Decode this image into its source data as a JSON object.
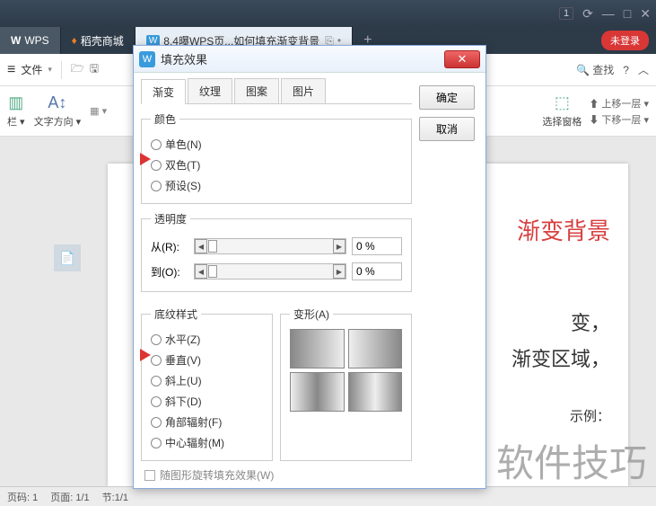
{
  "titlebar": {
    "count": "1"
  },
  "tabs": {
    "app": "WPS",
    "mall": "稻壳商城",
    "doc": "8.4曝WPS页...如何填充渐变背景",
    "login": "未登录"
  },
  "ribbon": {
    "file": "文件",
    "find": "查找"
  },
  "toolbar": {
    "col": "栏",
    "text_dir": "文字方向",
    "select_pane": "选择窗格",
    "up_layer": "上移一层",
    "down_layer": "下移一层"
  },
  "doc": {
    "title": "渐变背景",
    "line1": "变，",
    "line2": "渐变区域，",
    "example": "示例："
  },
  "dialog": {
    "title": "填充效果",
    "tabs": {
      "gradient": "渐变",
      "texture": "纹理",
      "pattern": "图案",
      "picture": "图片"
    },
    "ok": "确定",
    "cancel": "取消",
    "color_legend": "颜色",
    "color": {
      "one": "单色(N)",
      "two": "双色(T)",
      "preset": "预设(S)"
    },
    "trans_legend": "透明度",
    "trans": {
      "from": "从(R):",
      "to": "到(O):",
      "val": "0 %"
    },
    "style_legend": "底纹样式",
    "style": {
      "horiz": "水平(Z)",
      "vert": "垂直(V)",
      "diagup": "斜上(U)",
      "diagdown": "斜下(D)",
      "corner": "角部辐射(F)",
      "center": "中心辐射(M)"
    },
    "variants_legend": "变形(A)",
    "rotate": "随图形旋转填充效果(W)"
  },
  "status": {
    "page": "页码: 1",
    "pages": "页面: 1/1",
    "section": "节:1/1"
  },
  "watermark": "软件技巧"
}
